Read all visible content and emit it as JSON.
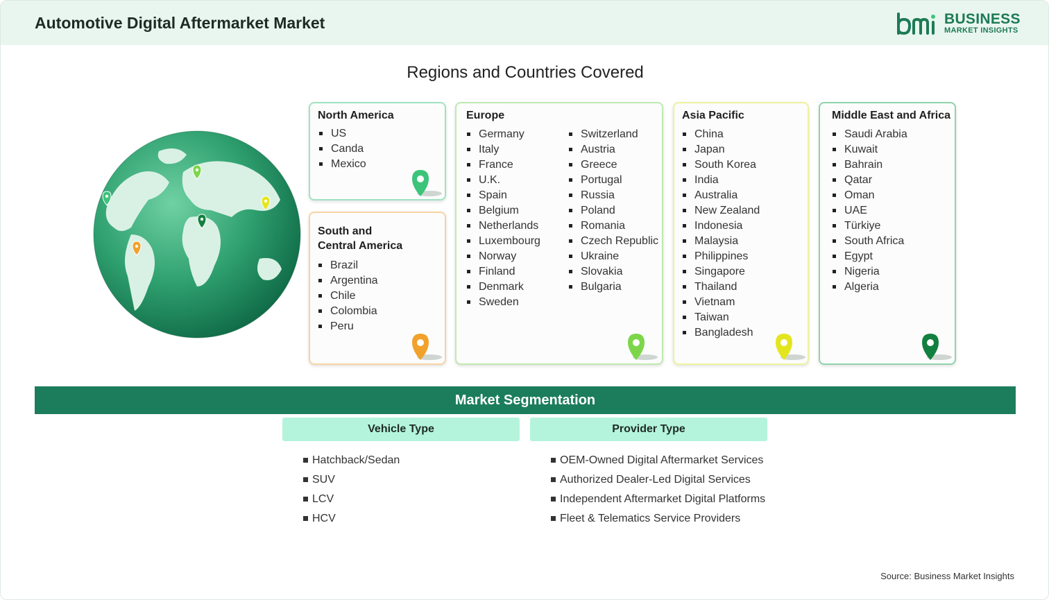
{
  "header": {
    "title": "Automotive Digital Aftermarket Market",
    "logo_word1": "BUSINESS",
    "logo_word2": "MARKET INSIGHTS"
  },
  "regions_title": "Regions and Countries Covered",
  "regions": {
    "north_america": {
      "title": "North America",
      "items": [
        "US",
        "Canda",
        "Mexico"
      ],
      "pin_color": "#3cc47a"
    },
    "south_central_america": {
      "title_line1": "South and",
      "title_line2": "Central America",
      "items": [
        "Brazil",
        "Argentina",
        "Chile",
        "Colombia",
        "Peru"
      ],
      "pin_color": "#f2a12b"
    },
    "europe": {
      "title": "Europe",
      "col1": [
        "Germany",
        "Italy",
        "France",
        "U.K.",
        "Spain",
        "Belgium",
        "Netherlands",
        "Luxembourg",
        "Norway",
        "Finland",
        "Denmark",
        "Sweden"
      ],
      "col2": [
        "Switzerland",
        "Austria",
        "Greece",
        "Portugal",
        "Russia",
        "Poland",
        "Romania",
        "Czech Republic",
        "Ukraine",
        "Slovakia",
        "Bulgaria"
      ],
      "pin_color": "#7dd64a"
    },
    "asia_pacific": {
      "title": "Asia Pacific",
      "items": [
        "China",
        "Japan",
        "South Korea",
        "India",
        "Australia",
        "New Zealand",
        "Indonesia",
        "Malaysia",
        "Philippines",
        "Singapore",
        "Thailand",
        "Vietnam",
        "Taiwan",
        "Bangladesh"
      ],
      "pin_color": "#e3e61f"
    },
    "middle_east_africa": {
      "title": "Middle East and Africa",
      "items": [
        "Saudi Arabia",
        "Kuwait",
        "Bahrain",
        "Qatar",
        "Oman",
        "UAE",
        "Türkiye",
        "South Africa",
        "Egypt",
        "Nigeria",
        "Algeria"
      ],
      "pin_color": "#12803f"
    }
  },
  "segmentation": {
    "title": "Market Segmentation",
    "vehicle_type": {
      "heading": "Vehicle Type",
      "items": [
        "Hatchback/Sedan",
        "SUV",
        "LCV",
        "HCV"
      ]
    },
    "provider_type": {
      "heading": "Provider Type",
      "items": [
        "OEM-Owned Digital Aftermarket Services",
        "Authorized Dealer-Led Digital Services",
        "Independent Aftermarket Digital Platforms",
        "Fleet & Telematics Service Providers"
      ]
    }
  },
  "source": "Source: Business Market Insights",
  "colors": {
    "accent": "#1b7d5b",
    "subheader": "#b4f4dc",
    "header_bg": "#e9f6ef"
  }
}
